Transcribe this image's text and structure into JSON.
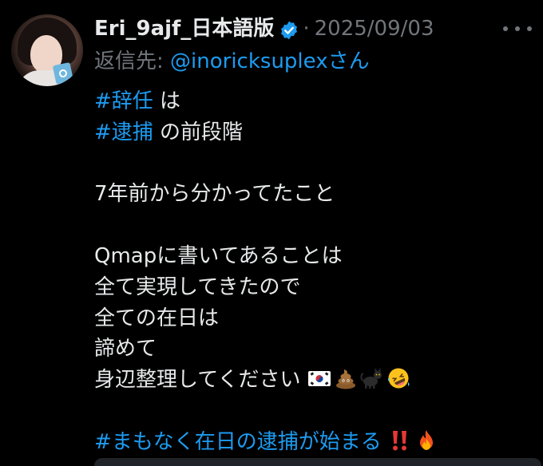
{
  "author": {
    "display_name": "Eri_9ajf_日本語版",
    "verified_icon": "verified-badge-icon",
    "separator": "·",
    "date": "2025/09/03"
  },
  "reply_to": {
    "label": "返信先:",
    "handle": "@inoricksuplex",
    "suffix": "さん"
  },
  "body": {
    "line1": {
      "tag": "#辞任",
      "text": " は"
    },
    "line2": {
      "tag": "#逮捕",
      "text": " の前段階"
    },
    "line4": "7年前から分かってたこと",
    "line6": "Qmapに書いてあることは",
    "line7": "全て実現してきたので",
    "line8": "全ての在日は",
    "line9": "諦めて",
    "line10": "身辺整理してください",
    "line10_emojis": [
      "korea-flag-icon",
      "poop-icon",
      "black-cat-icon",
      "rofl-face-icon"
    ],
    "line12": "#まもなく在日の逮捕が始まる",
    "line12_emojis": [
      "double-exclamation-icon",
      "fire-icon"
    ]
  },
  "colors": {
    "background": "#000000",
    "text": "#e7e9ea",
    "secondary": "#71767b",
    "accent": "#1d9bf0"
  }
}
